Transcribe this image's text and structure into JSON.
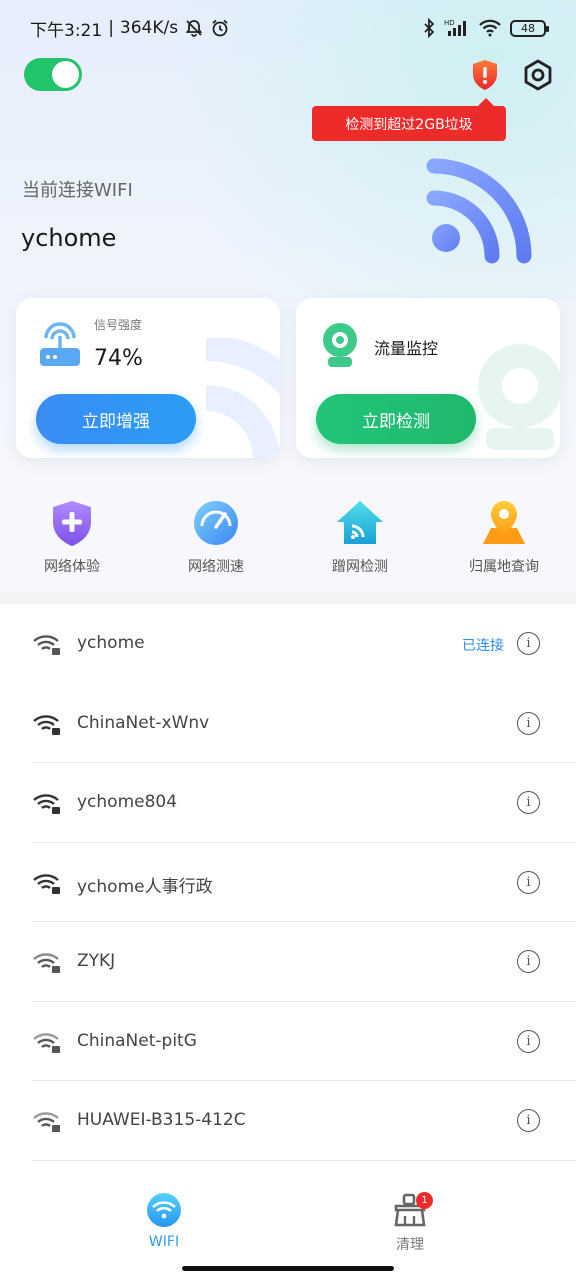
{
  "status_bar": {
    "time": "下午3:21",
    "speed": "364K/s",
    "battery": "48"
  },
  "header": {
    "toggle_on": true,
    "alert_text": "检测到超过2GB垃圾"
  },
  "current": {
    "label": "当前连接WIFI",
    "ssid": "ychome"
  },
  "cards": {
    "signal": {
      "caption": "信号强度",
      "value": "74%",
      "button": "立即增强"
    },
    "traffic": {
      "caption": "流量监控",
      "button": "立即检测"
    }
  },
  "tools": [
    {
      "label": "网络体验",
      "icon": "shield-plus-icon"
    },
    {
      "label": "网络测速",
      "icon": "speedometer-icon"
    },
    {
      "label": "蹭网检测",
      "icon": "home-wifi-icon"
    },
    {
      "label": "归属地查询",
      "icon": "location-pin-icon"
    }
  ],
  "wifi_list": [
    {
      "ssid": "ychome",
      "status": "已连接"
    },
    {
      "ssid": "ChinaNet-xWnv",
      "status": ""
    },
    {
      "ssid": "ychome804",
      "status": ""
    },
    {
      "ssid": "ychome人事行政",
      "status": ""
    },
    {
      "ssid": "ZYKJ",
      "status": ""
    },
    {
      "ssid": "ChinaNet-pitG",
      "status": ""
    },
    {
      "ssid": "HUAWEI-B315-412C",
      "status": ""
    }
  ],
  "info_glyph": "i",
  "bottom_nav": {
    "wifi_label": "WIFI",
    "clean_label": "清理",
    "clean_badge": "1"
  },
  "colors": {
    "accent_blue": "#2d9cf0",
    "accent_green": "#21c46a",
    "alert_red": "#ee2b2b"
  }
}
